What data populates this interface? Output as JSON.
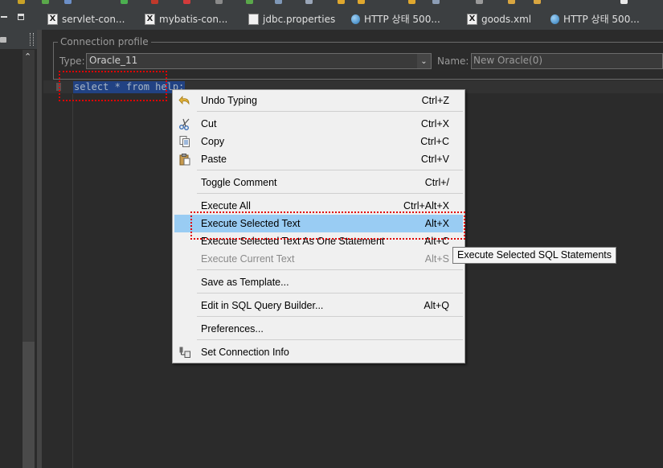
{
  "tabs": [
    {
      "label": "servlet-con...",
      "icon": "x-file-icon"
    },
    {
      "label": "mybatis-con...",
      "icon": "x-file-icon"
    },
    {
      "label": "jdbc.properties",
      "icon": "document-icon"
    },
    {
      "label": "HTTP 상태 500...",
      "icon": "globe-icon"
    },
    {
      "label": "goods.xml",
      "icon": "x-file-icon"
    },
    {
      "label": "HTTP 상태 500...",
      "icon": "globe-icon"
    }
  ],
  "profile": {
    "legend": "Connection profile",
    "type_label": "Type:",
    "type_value": "Oracle_11",
    "name_label": "Name:",
    "name_value": "New Oracle(0)"
  },
  "editor": {
    "sql": "select * from help;"
  },
  "menu": {
    "items": [
      {
        "label": "Undo Typing",
        "shortcut": "Ctrl+Z",
        "icon": "undo-icon"
      },
      {
        "label": "Cut",
        "shortcut": "Ctrl+X",
        "icon": "scissors-icon"
      },
      {
        "label": "Copy",
        "shortcut": "Ctrl+C",
        "icon": "copy-icon"
      },
      {
        "label": "Paste",
        "shortcut": "Ctrl+V",
        "icon": "paste-icon"
      },
      {
        "label": "Toggle Comment",
        "shortcut": "Ctrl+/"
      },
      {
        "label": "Execute All",
        "shortcut": "Ctrl+Alt+X"
      },
      {
        "label": "Execute Selected Text",
        "shortcut": "Alt+X"
      },
      {
        "label": "Execute Selected Text As One Statement",
        "shortcut": "Alt+C"
      },
      {
        "label": "Execute Current Text",
        "shortcut": "Alt+S"
      },
      {
        "label": "Save as Template..."
      },
      {
        "label": "Edit in SQL Query Builder...",
        "shortcut": "Alt+Q"
      },
      {
        "label": "Preferences..."
      },
      {
        "label": "Set Connection Info",
        "icon": "connection-info-icon"
      }
    ]
  },
  "tooltip": "Execute Selected SQL Statements"
}
